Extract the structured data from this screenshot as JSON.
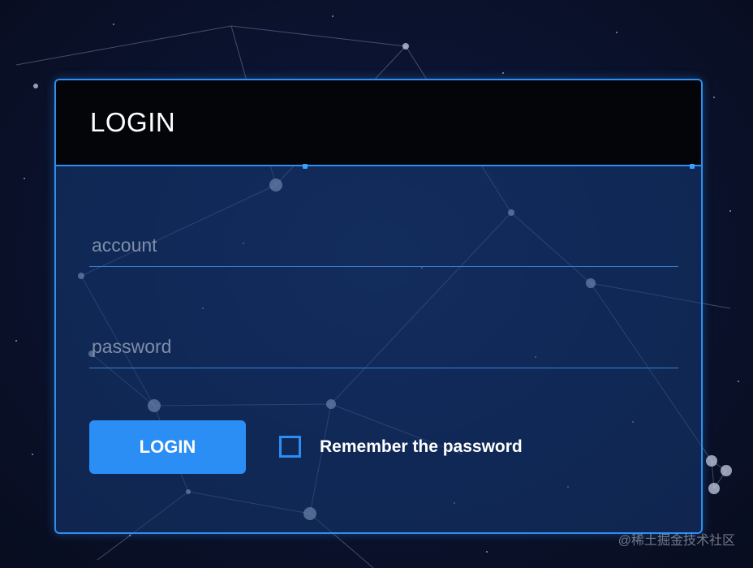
{
  "header": {
    "title": "LOGIN"
  },
  "form": {
    "account": {
      "value": "",
      "placeholder": "account"
    },
    "password": {
      "value": "",
      "placeholder": "password"
    },
    "login_button_label": "LOGIN",
    "remember": {
      "label": "Remember the password",
      "checked": false
    }
  },
  "watermark": "@稀土掘金技术社区",
  "colors": {
    "accent": "#2a8ef5",
    "panel_border": "#2f8ef0",
    "header_bg": "#030509",
    "background": "#0a1024"
  }
}
